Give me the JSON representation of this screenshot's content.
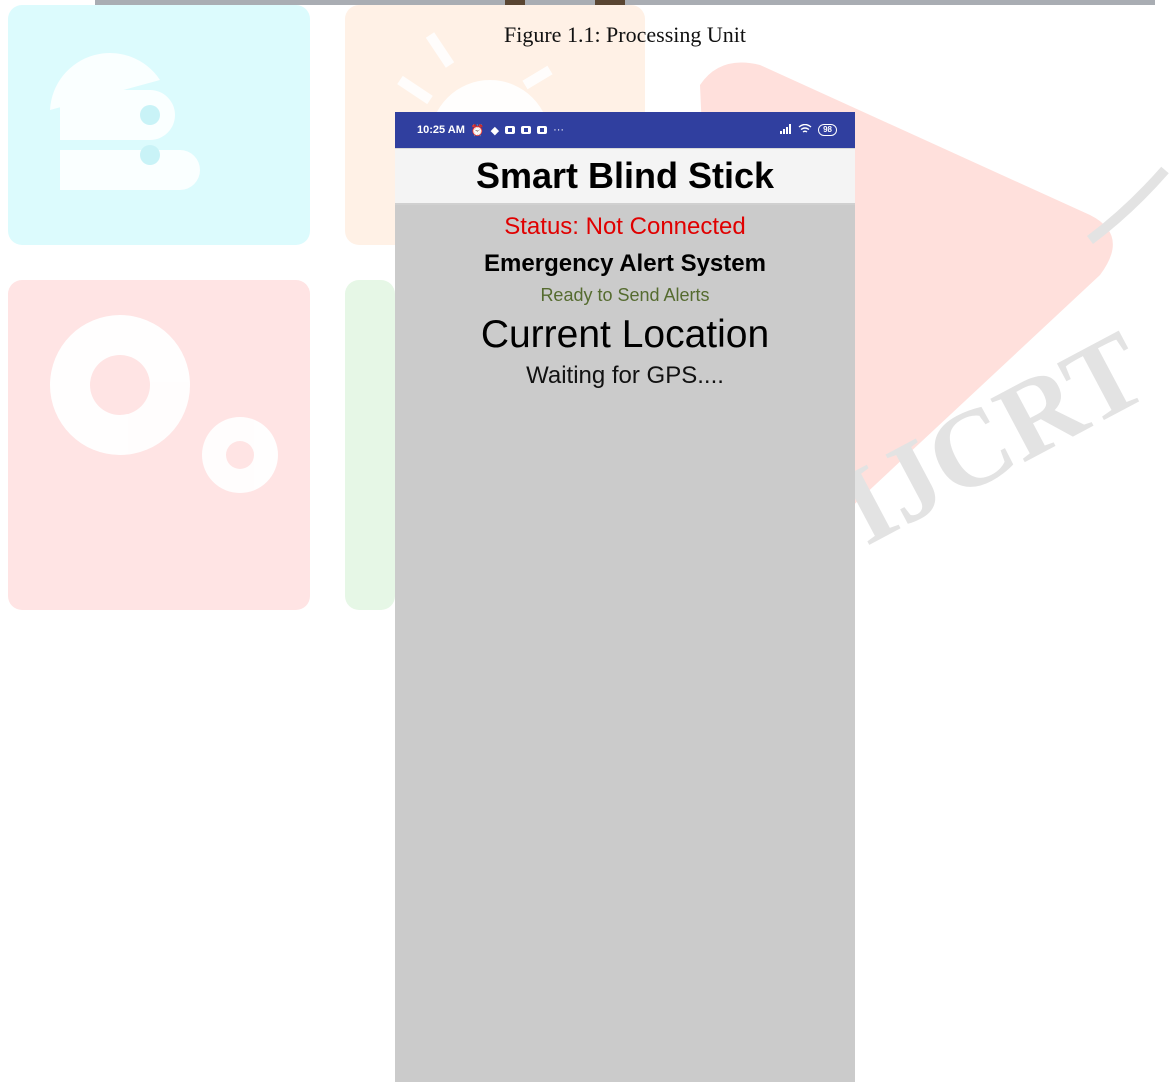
{
  "figure": {
    "caption": "Figure 1.1: Processing Unit"
  },
  "watermark": {
    "text": "IJCRT"
  },
  "phone": {
    "statusbar": {
      "time": "10:25 AM",
      "more": "···",
      "battery": "98"
    },
    "app_title": "Smart Blind Stick",
    "status_text": "Status: Not Connected",
    "alert_title": "Emergency Alert System",
    "alert_status": "Ready to Send Alerts",
    "location_title": "Current Location",
    "location_value": "Waiting for GPS...."
  },
  "colors": {
    "statusbar": "#303f9f",
    "status_error": "#e00000",
    "alert_ready": "#556b2f",
    "screen_bg": "#cbcbcb"
  }
}
